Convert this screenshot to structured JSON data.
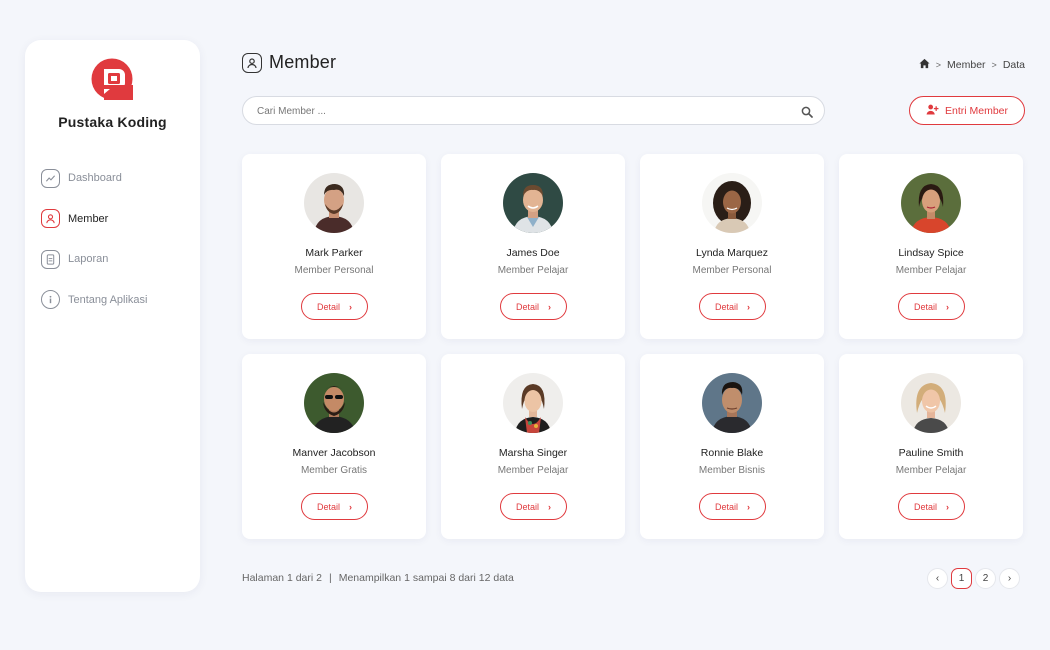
{
  "brand": {
    "name": "Pustaka Koding",
    "accent": "#e03a3e"
  },
  "sidebar": {
    "items": [
      {
        "label": "Dashboard",
        "icon": "chart-icon",
        "active": false
      },
      {
        "label": "Member",
        "icon": "user-icon",
        "active": true
      },
      {
        "label": "Laporan",
        "icon": "document-icon",
        "active": false
      },
      {
        "label": "Tentang Aplikasi",
        "icon": "info-icon",
        "active": false
      }
    ]
  },
  "header": {
    "title": "Member",
    "icon": "user-icon"
  },
  "breadcrumb": {
    "home_icon": "home-icon",
    "items": [
      "Member",
      "Data"
    ]
  },
  "search": {
    "placeholder": "Cari Member ...",
    "value": ""
  },
  "actions": {
    "add_member_label": "Entri Member",
    "add_member_icon": "user-plus-icon"
  },
  "members": [
    {
      "name": "Mark Parker",
      "type": "Member Personal",
      "detail_label": "Detail"
    },
    {
      "name": "James Doe",
      "type": "Member Pelajar",
      "detail_label": "Detail"
    },
    {
      "name": "Lynda Marquez",
      "type": "Member Personal",
      "detail_label": "Detail"
    },
    {
      "name": "Lindsay Spice",
      "type": "Member Pelajar",
      "detail_label": "Detail"
    },
    {
      "name": "Manver Jacobson",
      "type": "Member Gratis",
      "detail_label": "Detail"
    },
    {
      "name": "Marsha Singer",
      "type": "Member Pelajar",
      "detail_label": "Detail"
    },
    {
      "name": "Ronnie Blake",
      "type": "Member Bisnis",
      "detail_label": "Detail"
    },
    {
      "name": "Pauline Smith",
      "type": "Member Pelajar",
      "detail_label": "Detail"
    }
  ],
  "footer": {
    "page_info": "Halaman 1 dari 2",
    "separator": "|",
    "range_info": "Menampilkan 1 sampai 8 dari 12 data"
  },
  "pagination": {
    "prev": "‹",
    "next": "›",
    "pages": [
      "1",
      "2"
    ],
    "current": "1"
  }
}
